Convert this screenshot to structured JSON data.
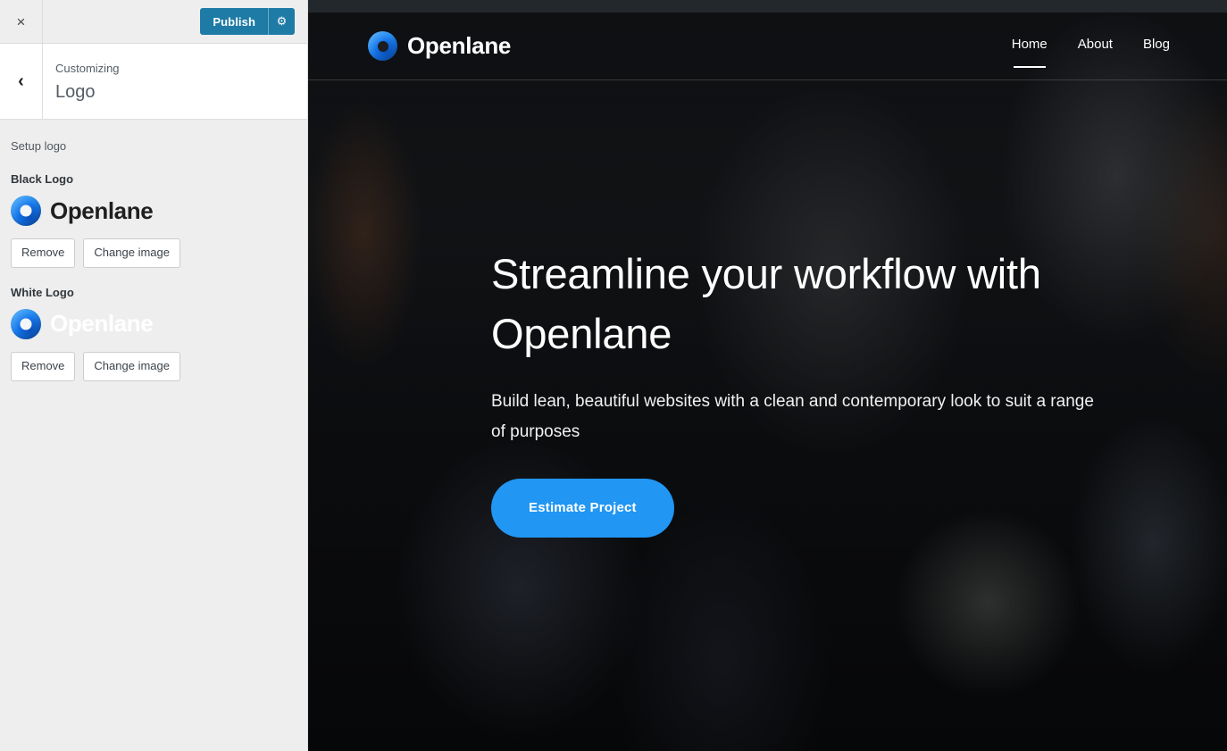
{
  "customizer": {
    "close_label": "×",
    "close_icon": "close-icon",
    "publish_label": "Publish",
    "gear_icon": "⚙",
    "back_label": "‹",
    "eyebrow": "Customizing",
    "title": "Logo",
    "description": "Setup logo",
    "sections": [
      {
        "label": "Black Logo",
        "logo_text": "Openlane",
        "remove_label": "Remove",
        "change_label": "Change image"
      },
      {
        "label": "White Logo",
        "logo_text": "Openlane",
        "remove_label": "Remove",
        "change_label": "Change image"
      }
    ]
  },
  "preview": {
    "brand_name": "Openlane",
    "nav": [
      {
        "label": "Home",
        "active": true
      },
      {
        "label": "About",
        "active": false
      },
      {
        "label": "Blog",
        "active": false
      }
    ],
    "hero": {
      "title": "Streamline your workflow with Openlane",
      "subtitle": "Build lean, beautiful websites with a clean and contemporary look to suit a range of purposes",
      "cta_label": "Estimate Project"
    }
  },
  "colors": {
    "publish_blue": "#1e7ba6",
    "cta_blue": "#2196f3",
    "logo_blue": "#1472e8",
    "sidebar_bg": "#eeeeee",
    "topbar_dark": "#23282d"
  }
}
